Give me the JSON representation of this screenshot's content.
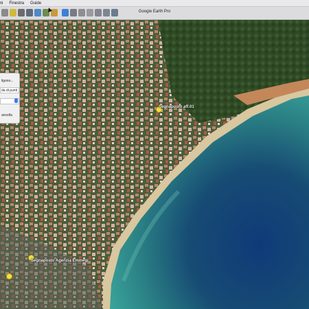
{
  "menubar": {
    "items": [
      "mi",
      "Finestra",
      "Guide"
    ]
  },
  "window": {
    "title": "Google Earth Pro"
  },
  "toolbar": {
    "icons": [
      "sidebar-icon",
      "placemark-icon",
      "polygon-icon",
      "path-icon",
      "overlay-icon",
      "tour-icon",
      "planet-icon",
      "sun-icon",
      "history-icon",
      "ruler-icon",
      "email-icon",
      "print-icon",
      "save-image-icon",
      "map-view-icon"
    ]
  },
  "dialog": {
    "line1": "ligono...",
    "line2": "da di punti",
    "line3": "ancella"
  },
  "placemarks": [
    {
      "label": "Segnaposto aff.01"
    },
    {
      "label": "Segnaposto Agenzia Emmegi"
    }
  ],
  "colors": {
    "sea_deep": "#123a66",
    "sea_shallow": "#2f8f8c",
    "land": "#3a5a2e",
    "beach": "#d9cba8",
    "pin": "#f7e23a"
  }
}
